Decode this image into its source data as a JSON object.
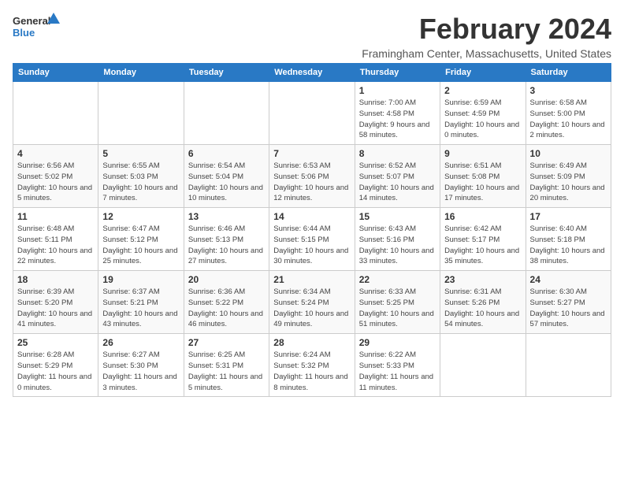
{
  "logo": {
    "line1": "General",
    "line2": "Blue"
  },
  "title": "February 2024",
  "location": "Framingham Center, Massachusetts, United States",
  "days_of_week": [
    "Sunday",
    "Monday",
    "Tuesday",
    "Wednesday",
    "Thursday",
    "Friday",
    "Saturday"
  ],
  "weeks": [
    [
      {
        "day": "",
        "info": ""
      },
      {
        "day": "",
        "info": ""
      },
      {
        "day": "",
        "info": ""
      },
      {
        "day": "",
        "info": ""
      },
      {
        "day": "1",
        "info": "Sunrise: 7:00 AM\nSunset: 4:58 PM\nDaylight: 9 hours and 58 minutes."
      },
      {
        "day": "2",
        "info": "Sunrise: 6:59 AM\nSunset: 4:59 PM\nDaylight: 10 hours and 0 minutes."
      },
      {
        "day": "3",
        "info": "Sunrise: 6:58 AM\nSunset: 5:00 PM\nDaylight: 10 hours and 2 minutes."
      }
    ],
    [
      {
        "day": "4",
        "info": "Sunrise: 6:56 AM\nSunset: 5:02 PM\nDaylight: 10 hours and 5 minutes."
      },
      {
        "day": "5",
        "info": "Sunrise: 6:55 AM\nSunset: 5:03 PM\nDaylight: 10 hours and 7 minutes."
      },
      {
        "day": "6",
        "info": "Sunrise: 6:54 AM\nSunset: 5:04 PM\nDaylight: 10 hours and 10 minutes."
      },
      {
        "day": "7",
        "info": "Sunrise: 6:53 AM\nSunset: 5:06 PM\nDaylight: 10 hours and 12 minutes."
      },
      {
        "day": "8",
        "info": "Sunrise: 6:52 AM\nSunset: 5:07 PM\nDaylight: 10 hours and 14 minutes."
      },
      {
        "day": "9",
        "info": "Sunrise: 6:51 AM\nSunset: 5:08 PM\nDaylight: 10 hours and 17 minutes."
      },
      {
        "day": "10",
        "info": "Sunrise: 6:49 AM\nSunset: 5:09 PM\nDaylight: 10 hours and 20 minutes."
      }
    ],
    [
      {
        "day": "11",
        "info": "Sunrise: 6:48 AM\nSunset: 5:11 PM\nDaylight: 10 hours and 22 minutes."
      },
      {
        "day": "12",
        "info": "Sunrise: 6:47 AM\nSunset: 5:12 PM\nDaylight: 10 hours and 25 minutes."
      },
      {
        "day": "13",
        "info": "Sunrise: 6:46 AM\nSunset: 5:13 PM\nDaylight: 10 hours and 27 minutes."
      },
      {
        "day": "14",
        "info": "Sunrise: 6:44 AM\nSunset: 5:15 PM\nDaylight: 10 hours and 30 minutes."
      },
      {
        "day": "15",
        "info": "Sunrise: 6:43 AM\nSunset: 5:16 PM\nDaylight: 10 hours and 33 minutes."
      },
      {
        "day": "16",
        "info": "Sunrise: 6:42 AM\nSunset: 5:17 PM\nDaylight: 10 hours and 35 minutes."
      },
      {
        "day": "17",
        "info": "Sunrise: 6:40 AM\nSunset: 5:18 PM\nDaylight: 10 hours and 38 minutes."
      }
    ],
    [
      {
        "day": "18",
        "info": "Sunrise: 6:39 AM\nSunset: 5:20 PM\nDaylight: 10 hours and 41 minutes."
      },
      {
        "day": "19",
        "info": "Sunrise: 6:37 AM\nSunset: 5:21 PM\nDaylight: 10 hours and 43 minutes."
      },
      {
        "day": "20",
        "info": "Sunrise: 6:36 AM\nSunset: 5:22 PM\nDaylight: 10 hours and 46 minutes."
      },
      {
        "day": "21",
        "info": "Sunrise: 6:34 AM\nSunset: 5:24 PM\nDaylight: 10 hours and 49 minutes."
      },
      {
        "day": "22",
        "info": "Sunrise: 6:33 AM\nSunset: 5:25 PM\nDaylight: 10 hours and 51 minutes."
      },
      {
        "day": "23",
        "info": "Sunrise: 6:31 AM\nSunset: 5:26 PM\nDaylight: 10 hours and 54 minutes."
      },
      {
        "day": "24",
        "info": "Sunrise: 6:30 AM\nSunset: 5:27 PM\nDaylight: 10 hours and 57 minutes."
      }
    ],
    [
      {
        "day": "25",
        "info": "Sunrise: 6:28 AM\nSunset: 5:29 PM\nDaylight: 11 hours and 0 minutes."
      },
      {
        "day": "26",
        "info": "Sunrise: 6:27 AM\nSunset: 5:30 PM\nDaylight: 11 hours and 3 minutes."
      },
      {
        "day": "27",
        "info": "Sunrise: 6:25 AM\nSunset: 5:31 PM\nDaylight: 11 hours and 5 minutes."
      },
      {
        "day": "28",
        "info": "Sunrise: 6:24 AM\nSunset: 5:32 PM\nDaylight: 11 hours and 8 minutes."
      },
      {
        "day": "29",
        "info": "Sunrise: 6:22 AM\nSunset: 5:33 PM\nDaylight: 11 hours and 11 minutes."
      },
      {
        "day": "",
        "info": ""
      },
      {
        "day": "",
        "info": ""
      }
    ]
  ]
}
